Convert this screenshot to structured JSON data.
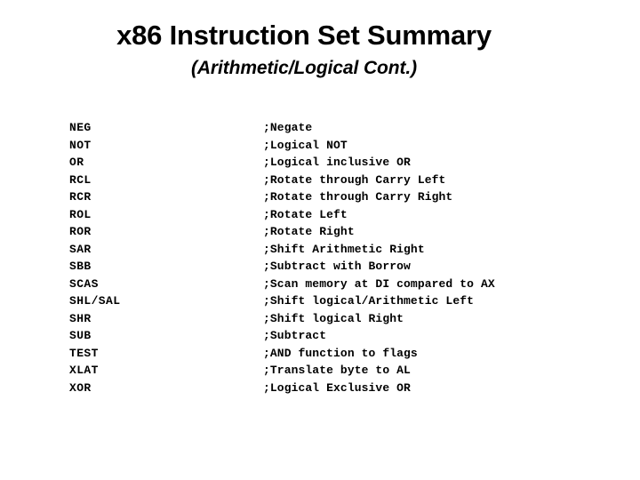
{
  "slide": {
    "title": "x86 Instruction Set Summary",
    "subtitle": "(Arithmetic/Logical Cont.)",
    "background_color": "#ffffff",
    "text_color": "#000000"
  },
  "instructions": [
    {
      "mnemonic": "NEG",
      "description": ";Negate"
    },
    {
      "mnemonic": "NOT",
      "description": ";Logical NOT"
    },
    {
      "mnemonic": "OR",
      "description": ";Logical inclusive OR"
    },
    {
      "mnemonic": "RCL",
      "description": ";Rotate through Carry Left"
    },
    {
      "mnemonic": "RCR",
      "description": ";Rotate through Carry Right"
    },
    {
      "mnemonic": "ROL",
      "description": ";Rotate Left"
    },
    {
      "mnemonic": "ROR",
      "description": ";Rotate Right"
    },
    {
      "mnemonic": "SAR",
      "description": ";Shift Arithmetic Right"
    },
    {
      "mnemonic": "SBB",
      "description": ";Subtract with Borrow"
    },
    {
      "mnemonic": "SCAS",
      "description": ";Scan memory at DI compared to AX"
    },
    {
      "mnemonic": "SHL/SAL",
      "description": ";Shift logical/Arithmetic Left"
    },
    {
      "mnemonic": "SHR",
      "description": ";Shift logical Right"
    },
    {
      "mnemonic": "SUB",
      "description": ";Subtract"
    },
    {
      "mnemonic": "TEST",
      "description": ";AND function to flags"
    },
    {
      "mnemonic": "XLAT",
      "description": ";Translate byte to AL"
    },
    {
      "mnemonic": "XOR",
      "description": ";Logical Exclusive OR"
    }
  ]
}
